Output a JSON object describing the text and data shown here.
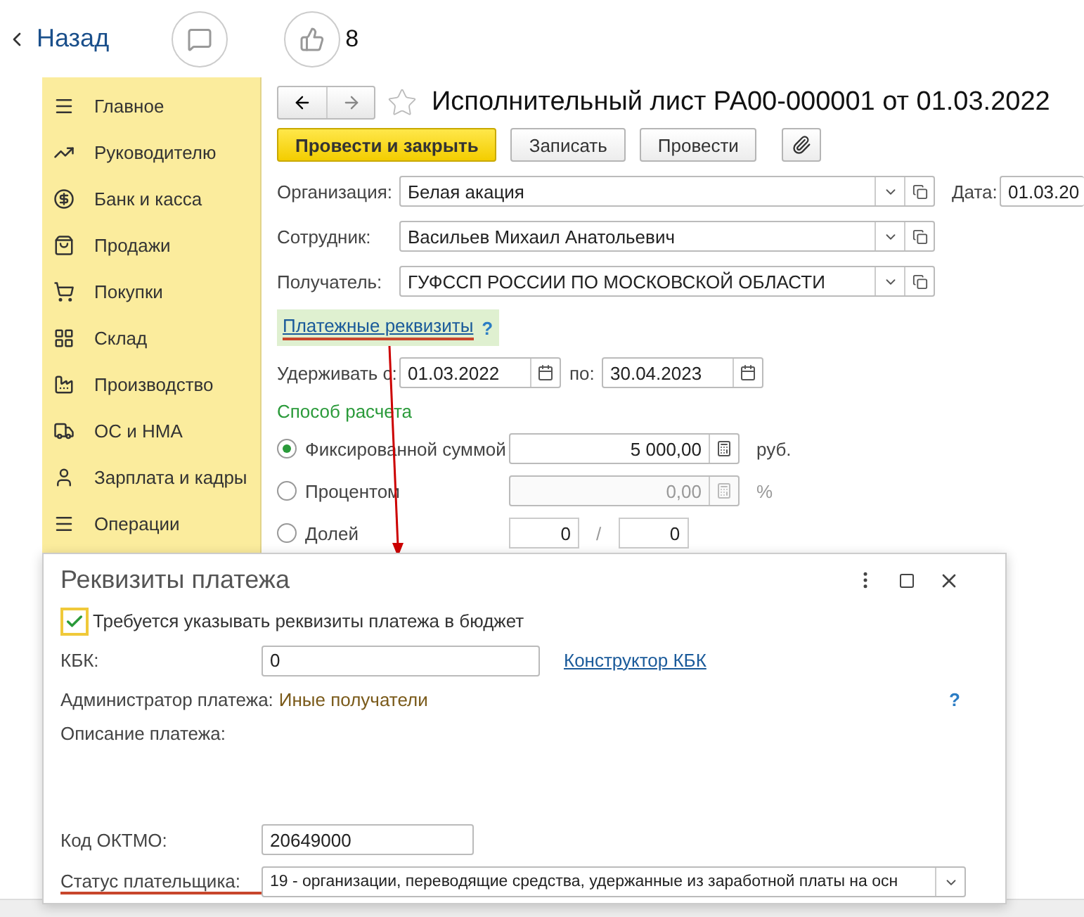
{
  "top_bar": {
    "back_label": "Назад",
    "likes": "8"
  },
  "sidebar": {
    "items": [
      {
        "label": "Главное"
      },
      {
        "label": "Руководителю"
      },
      {
        "label": "Банк и касса"
      },
      {
        "label": "Продажи"
      },
      {
        "label": "Покупки"
      },
      {
        "label": "Склад"
      },
      {
        "label": "Производство"
      },
      {
        "label": "ОС и НМА"
      },
      {
        "label": "Зарплата и кадры"
      },
      {
        "label": "Операции"
      }
    ]
  },
  "form": {
    "title": "Исполнительный лист РА00-000001 от 01.03.2022",
    "buttons": [
      {
        "label": "Провести и закрыть",
        "kind": "primary"
      },
      {
        "label": "Записать",
        "kind": "default"
      },
      {
        "label": "Провести",
        "kind": "default"
      }
    ],
    "organization": {
      "label": "Организация:",
      "value": "Белая акация"
    },
    "date": {
      "label": "Дата:",
      "value": "01.03.20"
    },
    "employee": {
      "label": "Сотрудник:",
      "value": "Васильев Михаил Анатольевич"
    },
    "recipient": {
      "label": "Получатель:",
      "value": "ГУФССП РОССИИ ПО МОСКОВСКОЙ ОБЛАСТИ"
    },
    "payment_link": "Платежные реквизиты",
    "help": "?",
    "period": {
      "from_label": "Удерживать с:",
      "from": "01.03.2022",
      "to_label": "по:",
      "to": "30.04.2023"
    },
    "method_title": "Способ расчета",
    "methods": [
      {
        "label": "Фиксированной суммой",
        "selected": true,
        "kind": "amount",
        "value": "5 000,00",
        "unit": "руб.",
        "disabled": false
      },
      {
        "label": "Процентом",
        "selected": false,
        "kind": "amount",
        "value": "0,00",
        "unit": "%",
        "disabled": true
      },
      {
        "label": "Долей",
        "selected": false,
        "kind": "share",
        "numerator": "0",
        "separator": "/",
        "denominator": "0"
      }
    ]
  },
  "dialog": {
    "title": "Реквизиты платежа",
    "budget": {
      "label": "Требуется указывать реквизиты платежа в бюджет",
      "checked": true
    },
    "kbk": {
      "label": "КБК:",
      "value": "0",
      "link": "Конструктор КБК"
    },
    "admin": {
      "label": "Администратор платежа:",
      "value": "Иные получатели"
    },
    "help": "?",
    "description_label": "Описание платежа:",
    "oktmo": {
      "label": "Код ОКТМО:",
      "value": "20649000"
    },
    "payer_status": {
      "label": "Статус плательщика:",
      "value": "19 - организации, переводящие средства, удержанные из заработной платы на осн"
    }
  }
}
